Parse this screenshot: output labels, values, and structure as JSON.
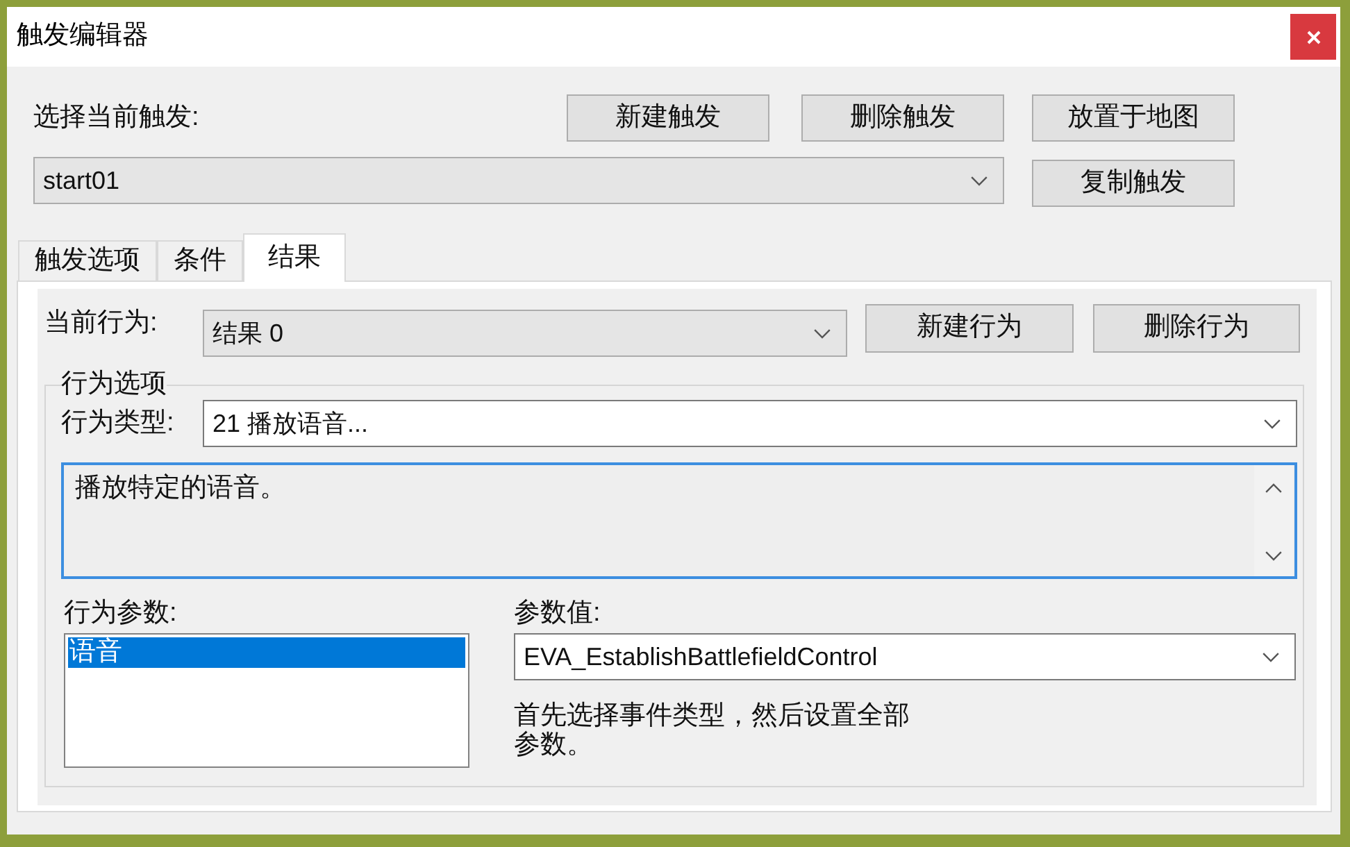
{
  "window": {
    "title": "触发编辑器"
  },
  "trigger_selector": {
    "label": "选择当前触发:",
    "value": "start01"
  },
  "trigger_buttons": [
    "新建触发",
    "删除触发",
    "放置于地图",
    "复制触发"
  ],
  "tabs": [
    {
      "label": "触发选项",
      "selected": false
    },
    {
      "label": "条件",
      "selected": false
    },
    {
      "label": "结果",
      "selected": true
    }
  ],
  "result_panel": {
    "current_action": {
      "label": "当前行为:",
      "value": "结果 0"
    },
    "action_buttons": [
      "新建行为",
      "删除行为"
    ],
    "action_options": {
      "title": "行为选项",
      "type_label": "行为类型:",
      "type_value": "21 播放语音...",
      "description": "播放特定的语音。",
      "parameters": {
        "label": "行为参数:",
        "items": [
          {
            "label": "语音",
            "selected": true
          }
        ]
      },
      "parameter_value": {
        "label": "参数值:",
        "value": "EVA_EstablishBattlefieldControl"
      },
      "hint": "首先选择事件类型，然后设置全部参数。"
    }
  }
}
